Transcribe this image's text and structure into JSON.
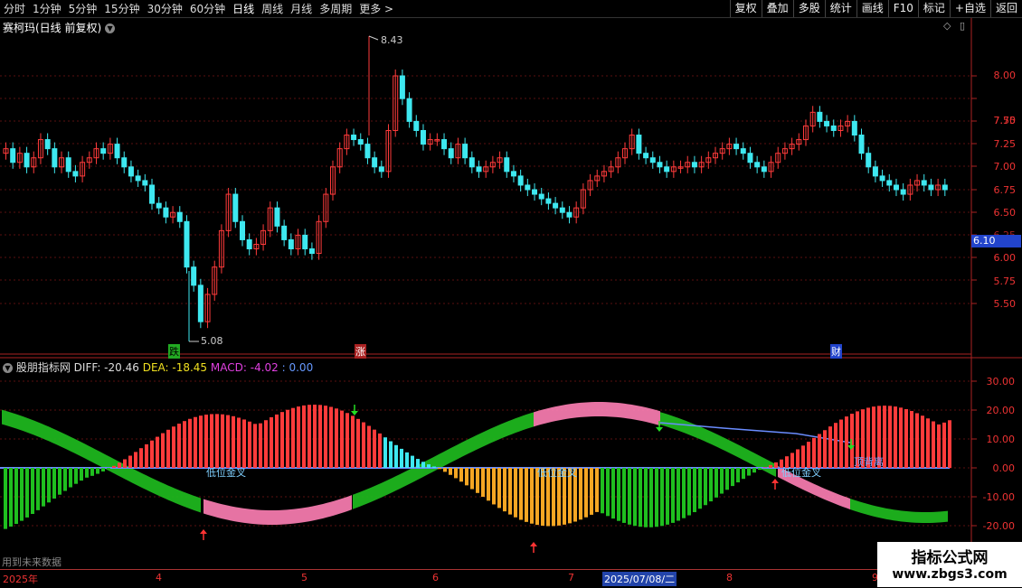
{
  "toolbar": {
    "periods": [
      "分时",
      "1分钟",
      "5分钟",
      "15分钟",
      "30分钟",
      "60分钟",
      "日线",
      "周线",
      "月线",
      "多周期",
      "更多 >"
    ],
    "actions": [
      "复权",
      "叠加",
      "多股",
      "统计",
      "画线",
      "F10",
      "标记",
      "+自选",
      "返回"
    ]
  },
  "main": {
    "title": "赛柯玛(日线 前复权)",
    "price_axis": [
      "8.00",
      "7.75",
      "7.50",
      "7.25",
      "7.00",
      "6.75",
      "6.50",
      "6.25",
      "6.00",
      "5.75",
      "5.50"
    ],
    "current_price": "6.10",
    "high_label": "8.43",
    "low_label": "5.08",
    "markers": {
      "die": "跌",
      "zhang": "涨",
      "cai": "财"
    }
  },
  "indicator": {
    "name": "股朋指标网",
    "diff": "DIFF: -20.46",
    "dea": "DEA: -18.45",
    "macd": "MACD: -4.02",
    "extra": ": 0.00",
    "axis": [
      "30.00",
      "20.00",
      "10.00",
      "0.00",
      "-10.00",
      "-20.00"
    ],
    "annotations": [
      "低位金叉",
      "低位金叉",
      "低位金叉",
      "顶背离"
    ],
    "future_note": "用到未来数据"
  },
  "time_axis": {
    "labels": [
      "2025年",
      "4",
      "5",
      "6",
      "7",
      "2025/07/08/二",
      "8",
      "9"
    ]
  },
  "watermark": {
    "title": "指标公式网",
    "url": "www.zbgs3.com"
  },
  "colors": {
    "up": "#ff3b3b",
    "down": "#3ee8f0",
    "green": "#1fbf1f",
    "orange": "#f5a623",
    "pink": "#ff7fb5",
    "axis": "#ff3333"
  }
}
